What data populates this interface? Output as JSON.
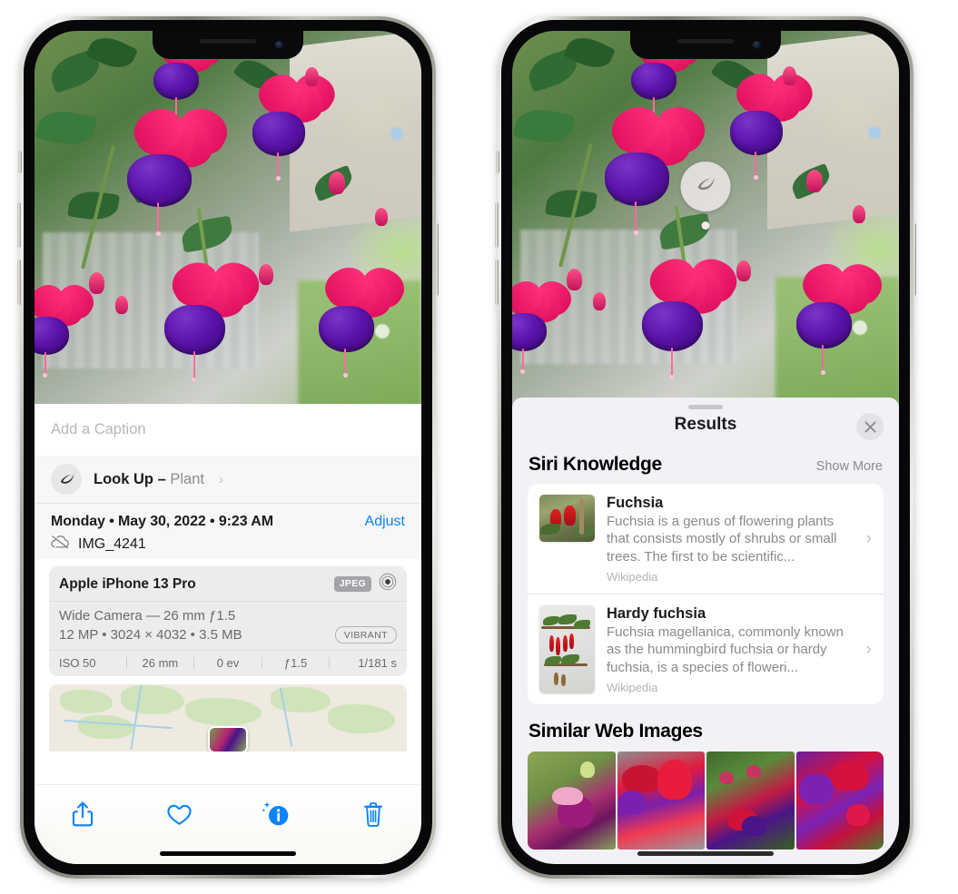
{
  "left_phone": {
    "name": "iphone-photos-info-view",
    "caption": {
      "placeholder": "Add a Caption",
      "value": ""
    },
    "look_up": {
      "label": "Look Up",
      "dash": "–",
      "subject": "Plant",
      "chevron": "›",
      "icon": "leaf-icon"
    },
    "metadata": {
      "date_line": "Monday • May 30, 2022 • 9:23 AM",
      "adjust_label": "Adjust",
      "filename": "IMG_4241",
      "cloud_icon": "icloud-slash-icon"
    },
    "camera_card": {
      "device": "Apple iPhone 13 Pro",
      "format_chip": "JPEG",
      "raw_icon": "raw-circle-icon",
      "lens_line": "Wide Camera — 26 mm ƒ1.5",
      "specs_line": "12 MP • 3024 × 4032 • 3.5 MB",
      "style_chip": "VIBRANT",
      "exif": [
        "ISO 50",
        "26 mm",
        "0 ev",
        "ƒ1.5",
        "1/181 s"
      ]
    },
    "toolbar": [
      {
        "label": "Share",
        "icon": "share-icon"
      },
      {
        "label": "Favorite",
        "icon": "heart-icon"
      },
      {
        "label": "Info",
        "icon": "info-sparkle-icon"
      },
      {
        "label": "Delete",
        "icon": "trash-icon"
      }
    ],
    "accent_color": "#0a84ff"
  },
  "right_phone": {
    "name": "iphone-visual-look-up-results",
    "photo_badge": {
      "icon": "leaf-icon",
      "tooltip_dot": true
    },
    "sheet": {
      "title": "Results",
      "close_icon": "close-x-icon",
      "grabber": true,
      "siri_knowledge": {
        "heading": "Siri Knowledge",
        "show_more": "Show More",
        "items": [
          {
            "title": "Fuchsia",
            "description": "Fuchsia is a genus of flowering plants that consists mostly of shrubs or small trees. The first to be scientific...",
            "source": "Wikipedia",
            "chevron": "›",
            "thumb": "fuchsia-red-flowers-thumb"
          },
          {
            "title": "Hardy fuchsia",
            "description": "Fuchsia magellanica, commonly known as the hummingbird fuchsia or hardy fuchsia, is a species of floweri...",
            "source": "Wikipedia",
            "chevron": "›",
            "thumb": "hardy-fuchsia-specimen-thumb"
          }
        ]
      },
      "similar_web_images": {
        "heading": "Similar Web Images",
        "items": [
          "fuchsia-pink-purple-bloom",
          "fuchsia-red-closeup",
          "fuchsia-bush-buds",
          "fuchsia-purple-magenta-cluster"
        ]
      }
    }
  }
}
